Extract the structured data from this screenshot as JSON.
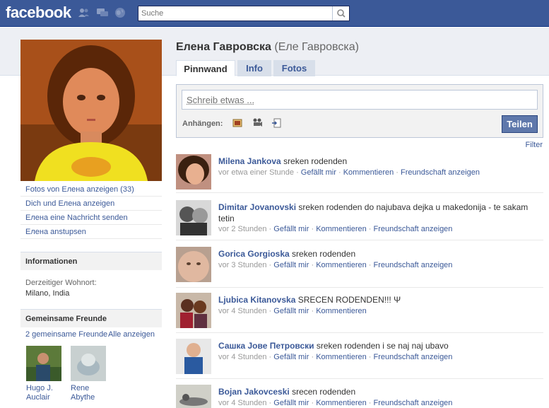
{
  "topbar": {
    "logo": "facebook",
    "search_placeholder": "Suche"
  },
  "profile": {
    "name": "Елена Гавровска",
    "alt_name": "(Еле Гавровска)",
    "left_links": [
      "Fotos von Елена anzeigen (33)",
      "Dich und Елена anzeigen",
      "Елена eine Nachricht senden",
      "Елена anstupsen"
    ]
  },
  "info": {
    "header": "Informationen",
    "label": "Derzeitiger Wohnort:",
    "value": "Milano, India"
  },
  "friends": {
    "header": "Gemeinsame Freunde",
    "count_link": "2 gemeinsame Freunde",
    "see_all": "Alle anzeigen",
    "items": [
      {
        "first": "Hugo J.",
        "last": "Auclair"
      },
      {
        "first": "Rene",
        "last": "Abythe"
      }
    ]
  },
  "tabs": [
    "Pinnwand",
    "Info",
    "Fotos"
  ],
  "composer": {
    "placeholder": "Schreib etwas ...",
    "attach_label": "Anhängen:",
    "share_label": "Teilen"
  },
  "filter_label": "Filter",
  "actions": {
    "like": "Gefällt mir",
    "comment": "Kommentieren",
    "friendship": "Freundschaft anzeigen",
    "sep": " · "
  },
  "posts": [
    {
      "author": "Milena Jankova",
      "text": "sreken rodenden",
      "time": "vor etwa einer Stunde",
      "friendship": true
    },
    {
      "author": "Dimitar Jovanovski",
      "text": "sreken rodenden do najubava dejka u makedonija - te sakam tetin",
      "time": "vor 2 Stunden",
      "friendship": true
    },
    {
      "author": "Gorica Gorgioska",
      "text": "sreken rodenden",
      "time": "vor 3 Stunden",
      "friendship": true
    },
    {
      "author": "Ljubica Kitanovska",
      "text": "SRECEN RODENDEN!!! Ψ",
      "time": "vor 4 Stunden",
      "friendship": false
    },
    {
      "author": "Сашка Јове Петровски",
      "text": "sreken rodenden i se naj naj ubavo",
      "time": "vor 4 Stunden",
      "friendship": true
    },
    {
      "author": "Bojan Jakovceski",
      "text": "srecen rodenden",
      "time": "vor 4 Stunden",
      "friendship": true
    }
  ]
}
